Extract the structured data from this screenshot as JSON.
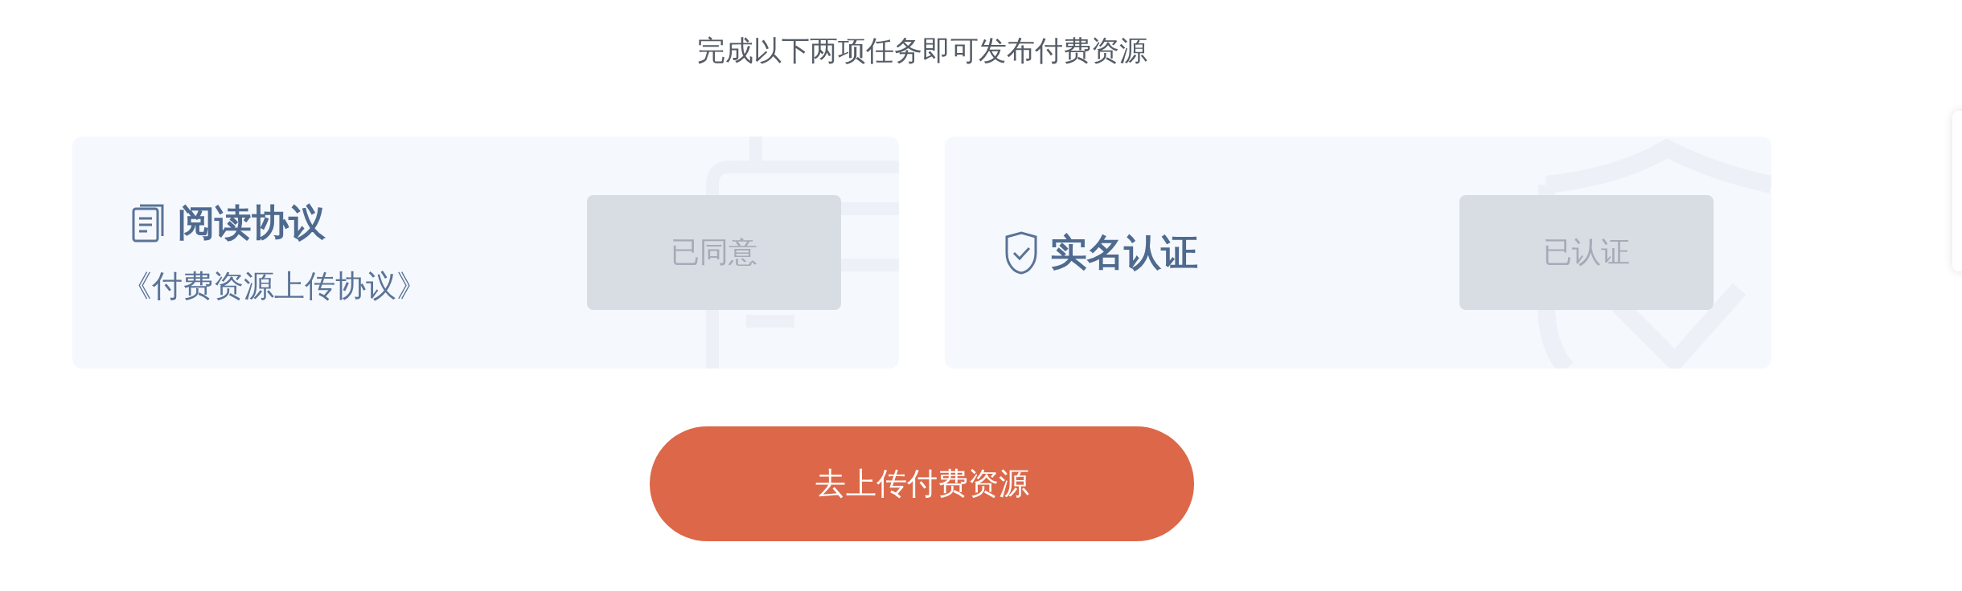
{
  "heading": "完成以下两项任务即可发布付费资源",
  "tasks": [
    {
      "kind": "agreement",
      "title": "阅读协议",
      "link": "《付费资源上传协议》",
      "action": "已同意",
      "done": true
    },
    {
      "kind": "verification",
      "title": "实名认证",
      "action": "已认证",
      "done": true
    }
  ],
  "submit": "去上传付费资源"
}
